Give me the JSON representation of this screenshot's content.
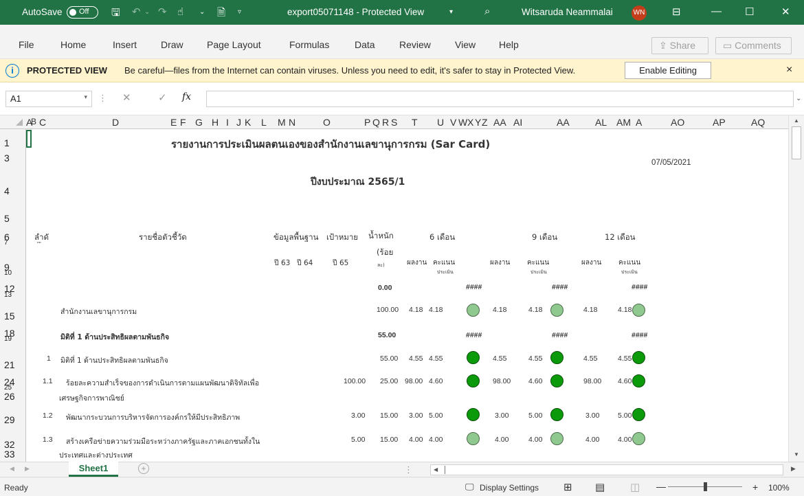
{
  "titlebar": {
    "autosave": "AutoSave",
    "autosave_state": "Off",
    "doc_title": "export05071148  -  Protected View",
    "user_name": "Witsaruda Neammalai",
    "user_initials": "WN"
  },
  "menu": {
    "items": [
      "File",
      "Home",
      "Insert",
      "Draw",
      "Page Layout",
      "Formulas",
      "Data",
      "Review",
      "View",
      "Help"
    ],
    "share": "Share",
    "comments": "Comments"
  },
  "banner": {
    "title": "PROTECTED VIEW",
    "message": "Be careful—files from the Internet can contain viruses. Unless you need to edit, it's safer to stay in Protected View.",
    "enable_button": "Enable Editing",
    "close": "×"
  },
  "formula_bar": {
    "name_box": "A1",
    "fx": "fx",
    "value": ""
  },
  "columns": [
    "A",
    "B",
    "C",
    "D",
    "E",
    "F",
    "G",
    "H",
    "I",
    "J",
    "K",
    "L",
    "M",
    "N",
    "O",
    "P",
    "Q",
    "R",
    "S",
    "T",
    "U",
    "V",
    "W",
    "X",
    "Y",
    "Z",
    "AA",
    "AI",
    "AA",
    "AL",
    "AM",
    "A",
    "AO",
    "AP",
    "AQ"
  ],
  "rows": [
    "1",
    "3",
    "4",
    "5",
    "6",
    "7",
    "9",
    "10",
    "12",
    "13",
    "15",
    "18",
    "19",
    "21",
    "24",
    "25",
    "26",
    "29",
    "32",
    "33"
  ],
  "sheet": {
    "report_title": "รายงานการประเมินผลตนเองของสำนักงานเลขานุการกรม (Sar Card)",
    "date": "07/05/2021",
    "fiscal_year": "ปีงบประมาณ 2565/1",
    "headers": {
      "seq": "ลำดั",
      "seq2": "\"\"",
      "indicator": "รายชื่อตัวชี้วัด",
      "baseline": "ข้อมูลพื้นฐาน",
      "target": "เป้าหมาย",
      "weight": "น้ำหนัก",
      "weight_unit": "(ร้อย",
      "weight_unit2": "ละ)",
      "m6": "6 เดือน",
      "m9": "9 เดือน",
      "m12": "12 เดือน",
      "y63": "ปี 63",
      "y64": "ปี 64",
      "y65": "ปี 65",
      "result": "ผลงาน",
      "score": "คะแนน",
      "score_sub": "ประเมิน"
    },
    "row12": {
      "weight": "0.00",
      "hash": "####"
    },
    "org": {
      "name": "สำนักงานเลขานุการกรม",
      "weight": "100.00",
      "r6": "4.18",
      "s6": "4.18",
      "r9": "4.18",
      "s9": "4.18",
      "r12": "4.18",
      "s12": "4.18",
      "status": [
        "light",
        "light",
        "light"
      ]
    },
    "dimension": {
      "name": "มิติที่ 1 ด้านประสิทธิผลตามพันธกิจ",
      "weight": "55.00",
      "hash": "####"
    },
    "items": [
      {
        "seq": "1",
        "name": "มิติที่ 1 ด้านประสิทธิผลตามพันธกิจ",
        "name2": "",
        "target": "",
        "weight": "55.00",
        "r6": "4.55",
        "s6": "4.55",
        "r9": "4.55",
        "s9": "4.55",
        "r12": "4.55",
        "s12": "4.55",
        "status": [
          "dark",
          "dark",
          "dark"
        ]
      },
      {
        "seq": "1.1",
        "name": "ร้อยละความสำเร็จของการดำเนินการตามแผนพัฒนาดิจิทัลเพื่อ",
        "name2": "เศรษฐกิจการพาณิชย์",
        "target": "100.00",
        "weight": "25.00",
        "r6": "98.00",
        "s6": "4.60",
        "r9": "98.00",
        "s9": "4.60",
        "r12": "98.00",
        "s12": "4.60",
        "status": [
          "dark",
          "dark",
          "dark"
        ]
      },
      {
        "seq": "1.2",
        "name": "พัฒนากระบวนการบริหารจัดการองค์กรให้มีประสิทธิภาพ",
        "name2": "",
        "target": "3.00",
        "weight": "15.00",
        "r6": "3.00",
        "s6": "5.00",
        "r9": "3.00",
        "s9": "5.00",
        "r12": "3.00",
        "s12": "5.00",
        "status": [
          "dark",
          "dark",
          "dark"
        ]
      },
      {
        "seq": "1.3",
        "name": "สร้างเครือข่ายความร่วมมือระหว่างภาครัฐและภาคเอกชนทั้งใน",
        "name2": "ประเทศและต่างประเทศ",
        "target": "5.00",
        "weight": "15.00",
        "r6": "4.00",
        "s6": "4.00",
        "r9": "4.00",
        "s9": "4.00",
        "r12": "4.00",
        "s12": "4.00",
        "status": [
          "light",
          "light",
          "light"
        ]
      }
    ]
  },
  "tabs": {
    "sheet1": "Sheet1",
    "add": "+"
  },
  "status": {
    "ready": "Ready",
    "display_settings": "Display Settings",
    "zoom": "100%"
  },
  "colors": {
    "accent": "#217346",
    "banner_bg": "#fff4ce",
    "dot_dark": "#0a9a0a",
    "dot_light": "#8fc98f"
  }
}
